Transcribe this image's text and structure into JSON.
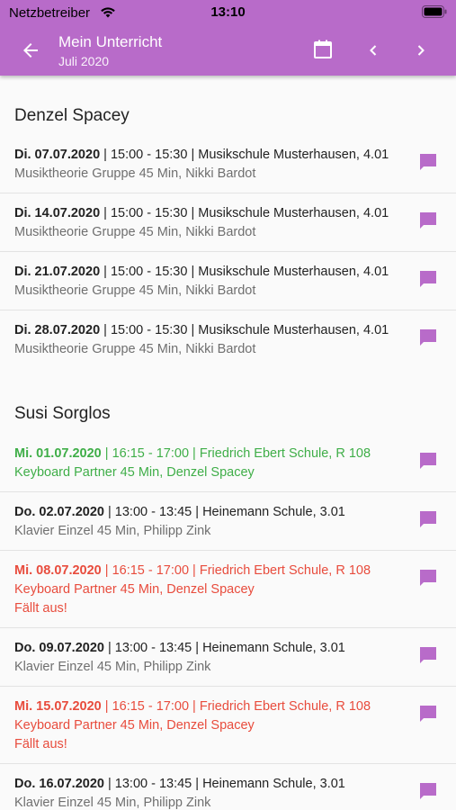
{
  "status": {
    "carrier": "Netzbetreiber",
    "time": "13:10"
  },
  "header": {
    "title": "Mein Unterricht",
    "subtitle": "Juli 2020"
  },
  "colors": {
    "accent": "#b86bc9",
    "green": "#3fae48",
    "red": "#e84c3d"
  },
  "sections": [
    {
      "name": "Denzel Spacey",
      "items": [
        {
          "date": "Di. 07.07.2020",
          "detail": " | 15:00 - 15:30 | Musikschule Musterhausen, 4.01",
          "sub": "Musiktheorie Gruppe 45 Min, Nikki Bardot"
        },
        {
          "date": "Di. 14.07.2020",
          "detail": " | 15:00 - 15:30 | Musikschule Musterhausen, 4.01",
          "sub": "Musiktheorie Gruppe 45 Min, Nikki Bardot"
        },
        {
          "date": "Di. 21.07.2020",
          "detail": " | 15:00 - 15:30 | Musikschule Musterhausen, 4.01",
          "sub": "Musiktheorie Gruppe 45 Min, Nikki Bardot"
        },
        {
          "date": "Di. 28.07.2020",
          "detail": " | 15:00 - 15:30 | Musikschule Musterhausen, 4.01",
          "sub": "Musiktheorie Gruppe 45 Min, Nikki Bardot"
        }
      ]
    },
    {
      "name": "Susi Sorglos",
      "items": [
        {
          "date": "Mi. 01.07.2020",
          "detail": " | 16:15 - 17:00 | Friedrich Ebert Schule, R 108",
          "sub": "Keyboard Partner 45 Min, Denzel Spacey",
          "state": "green"
        },
        {
          "date": "Do. 02.07.2020",
          "detail": " | 13:00 - 13:45 | Heinemann Schule, 3.01",
          "sub": "Klavier Einzel 45 Min, Philipp Zink"
        },
        {
          "date": "Mi. 08.07.2020",
          "detail": " | 16:15 - 17:00 | Friedrich Ebert Schule, R 108",
          "sub": "Keyboard Partner 45 Min, Denzel Spacey",
          "state": "red",
          "cancel": "Fällt aus!"
        },
        {
          "date": "Do. 09.07.2020",
          "detail": " | 13:00 - 13:45 | Heinemann Schule, 3.01",
          "sub": "Klavier Einzel 45 Min, Philipp Zink"
        },
        {
          "date": "Mi. 15.07.2020",
          "detail": " | 16:15 - 17:00 | Friedrich Ebert Schule, R 108",
          "sub": "Keyboard Partner 45 Min, Denzel Spacey",
          "state": "red",
          "cancel": "Fällt aus!"
        },
        {
          "date": "Do. 16.07.2020",
          "detail": " | 13:00 - 13:45 | Heinemann Schule, 3.01",
          "sub": "Klavier Einzel 45 Min, Philipp Zink"
        }
      ]
    }
  ]
}
